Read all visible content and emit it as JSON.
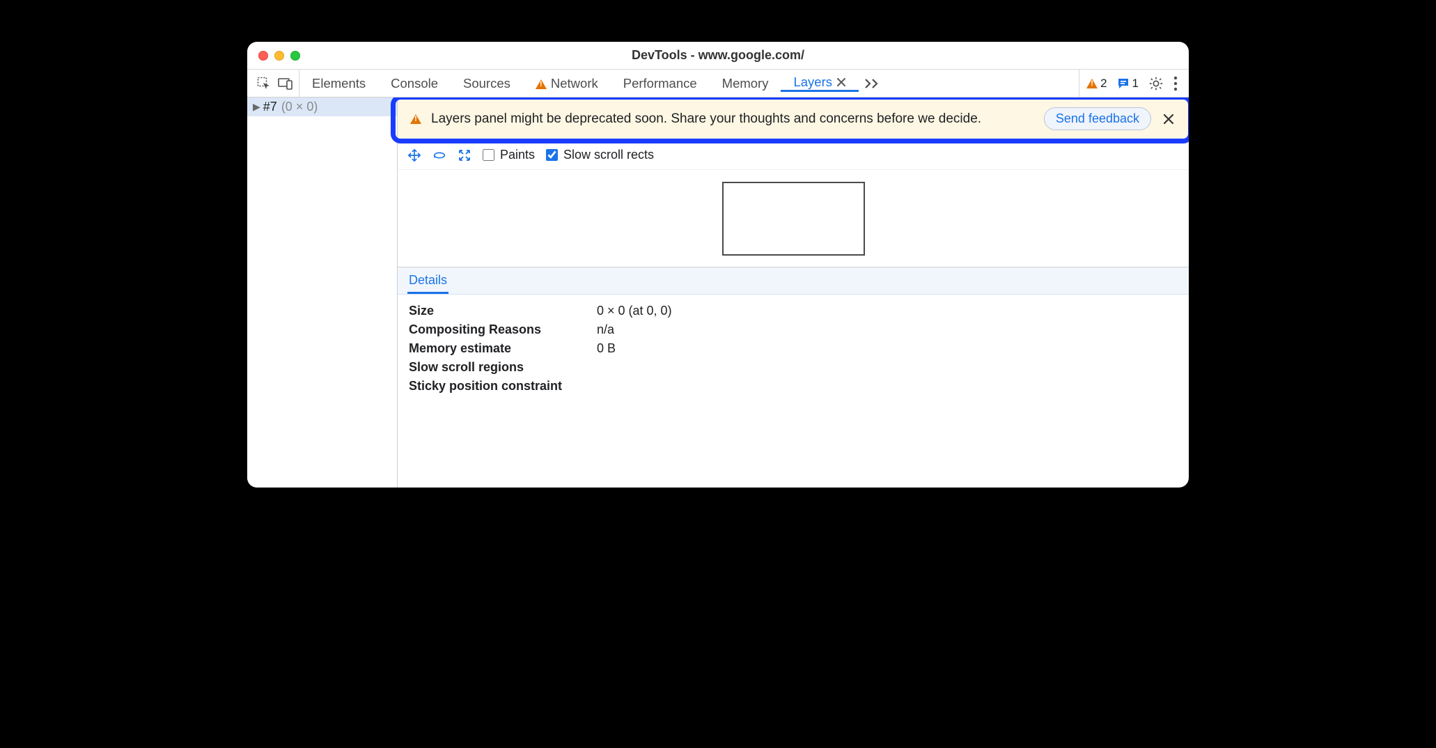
{
  "window": {
    "title": "DevTools - www.google.com/"
  },
  "tabs": {
    "items": [
      "Elements",
      "Console",
      "Sources",
      "Network",
      "Performance",
      "Memory",
      "Layers"
    ],
    "networkHasWarning": true,
    "active": "Layers"
  },
  "statusbar": {
    "warnings": "2",
    "messages": "1"
  },
  "tree": {
    "node": "#7",
    "dims": "(0 × 0)"
  },
  "banner": {
    "text": "Layers panel might be deprecated soon. Share your thoughts and concerns before we decide.",
    "button": "Send feedback"
  },
  "toolbar": {
    "paints_label": "Paints",
    "paints_checked": false,
    "slow_label": "Slow scroll rects",
    "slow_checked": true
  },
  "details": {
    "tab": "Details",
    "rows": {
      "size_k": "Size",
      "size_v": "0 × 0 (at 0, 0)",
      "comp_k": "Compositing Reasons",
      "comp_v": "n/a",
      "mem_k": "Memory estimate",
      "mem_v": "0 B",
      "slow_k": "Slow scroll regions",
      "slow_v": "",
      "sticky_k": "Sticky position constraint",
      "sticky_v": ""
    }
  }
}
